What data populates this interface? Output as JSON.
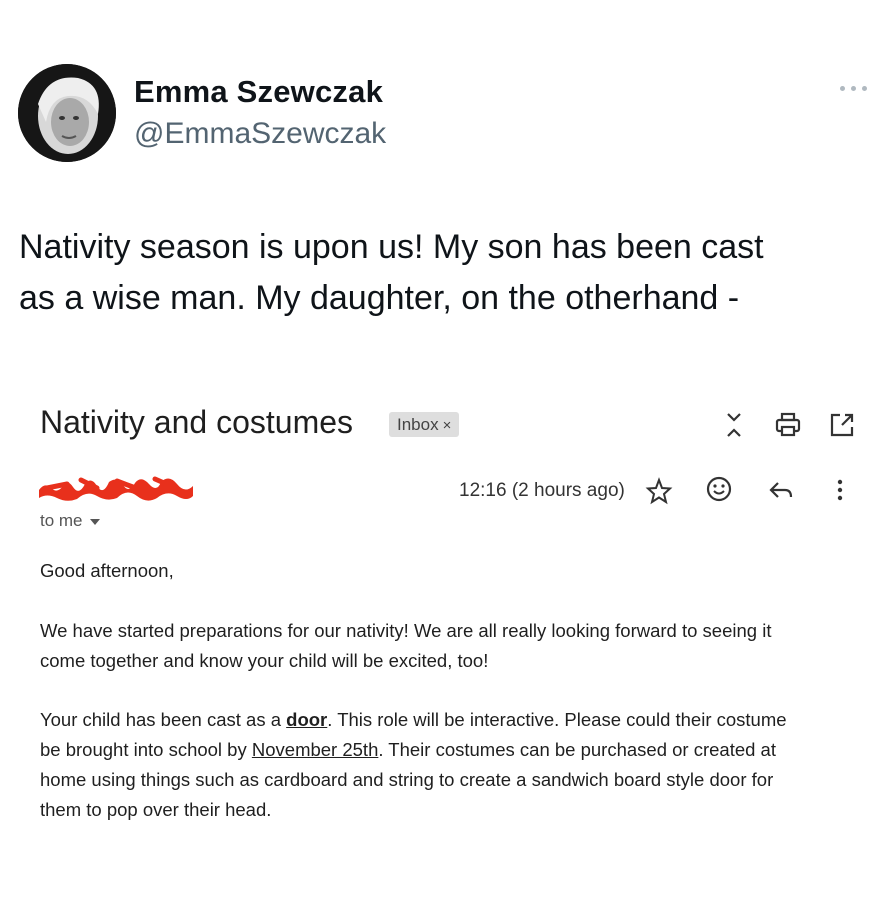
{
  "tweet": {
    "author_name": "Emma Szewczak",
    "author_handle": "@EmmaSzewczak",
    "text_line1": "Nativity season is upon us! My son has been cast",
    "text_line2": "as a wise man. My daughter, on the otherhand -"
  },
  "email": {
    "subject": "Nativity and costumes",
    "label": "Inbox",
    "label_close": "×",
    "time": "12:16 (2 hours ago)",
    "recipient": "to me",
    "greeting": "Good afternoon,",
    "p1_line1": "We have started preparations for our nativity! We are all really looking forward to seeing it",
    "p1_line2": "come together and know your child will be excited, too!",
    "p2_l1_pre": "Your child has been cast as a ",
    "p2_l1_door": "door",
    "p2_l1_post": ". This role will be interactive. Please could their costume",
    "p2_l2_pre": "be brought into school by ",
    "p2_l2_date": "November 25th",
    "p2_l2_post": ". Their costumes can be purchased or created at",
    "p2_line3": "home using things such as cardboard and string to create a sandwich board style door for",
    "p2_line4": "them to pop over their head.",
    "redaction_color": "#e8301c"
  },
  "icons": [
    "more-dots-icon",
    "expand-collapse-icon",
    "print-icon",
    "open-new-window-icon",
    "star-icon",
    "emoji-icon",
    "reply-icon",
    "more-vertical-icon",
    "chevron-down-icon"
  ]
}
